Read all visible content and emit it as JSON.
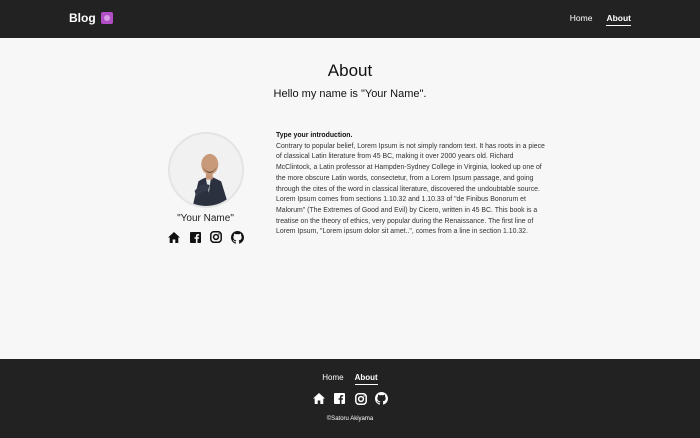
{
  "header": {
    "brand": "Blog",
    "nav": [
      {
        "label": "Home"
      },
      {
        "label": "About"
      }
    ]
  },
  "main": {
    "title": "About",
    "subtitle": "Hello my name is \"Your Name\".",
    "profile_name": "\"Your Name\"",
    "social_icons": [
      "home-icon",
      "facebook-icon",
      "instagram-icon",
      "github-icon"
    ],
    "intro_heading": "Type your introduction.",
    "intro_body": "Contrary to popular belief, Lorem Ipsum is not simply random text. It has roots in a piece of classical Latin literature from 45 BC, making it over 2000 years old. Richard McClintock, a Latin professor at Hampden-Sydney College in Virginia, looked up one of the more obscure Latin words, consectetur, from a Lorem Ipsum passage, and going through the cites of the word in classical literature, discovered the undoubtable source. Lorem Ipsum comes from sections 1.10.32 and 1.10.33 of \"de Finibus Bonorum et Malorum\" (The Extremes of Good and Evil) by Cicero, written in 45 BC. This book is a treatise on the theory of ethics, very popular during the Renaissance. The first line of Lorem Ipsum, \"Lorem ipsum dolor sit amet..\", comes from a line in section 1.10.32."
  },
  "footer": {
    "nav": [
      {
        "label": "Home"
      },
      {
        "label": "About"
      }
    ],
    "social_icons": [
      "home-icon",
      "facebook-icon",
      "instagram-icon",
      "github-icon"
    ],
    "copyright": "©Satoru Akiyama"
  },
  "colors": {
    "header_bg": "#222222",
    "page_bg": "#f7f7f7",
    "brand_logo": "#b14ec6"
  }
}
